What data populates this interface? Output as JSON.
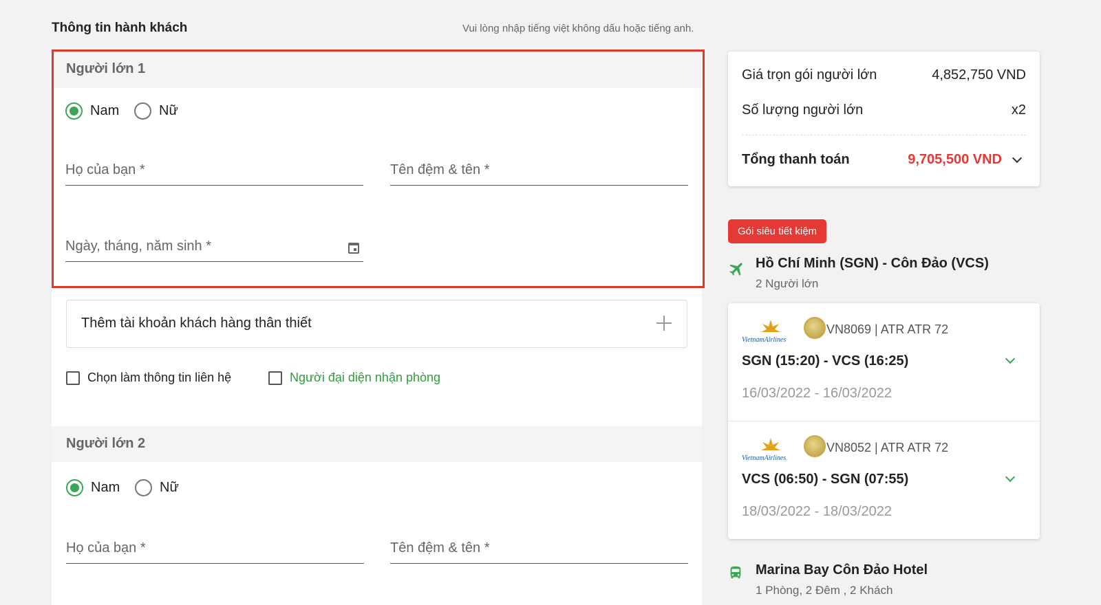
{
  "header": {
    "title": "Thông tin hành khách",
    "hint": "Vui lòng nhập tiếng việt không dấu hoặc tiếng anh."
  },
  "adult1": {
    "title": "Người lớn 1",
    "gender_male": "Nam",
    "gender_female": "Nữ",
    "selected_gender": "Nam",
    "last_name_placeholder": "Họ của bạn *",
    "first_name_placeholder": "Tên đệm & tên *",
    "dob_placeholder": "Ngày, tháng, năm sinh *"
  },
  "loyalty": {
    "label": "Thêm tài khoản khách hàng thân thiết"
  },
  "options": {
    "contact_label": "Chọn làm thông tin liên hệ",
    "checkin_rep_label": "Người đại diện nhận phòng"
  },
  "adult2": {
    "title": "Người lớn 2",
    "gender_male": "Nam",
    "gender_female": "Nữ",
    "selected_gender": "Nam",
    "last_name_placeholder": "Họ của bạn *",
    "first_name_placeholder": "Tên đệm & tên *"
  },
  "summary": {
    "package_price_label": "Giá trọn gói người lớn",
    "package_price_value": "4,852,750 VND",
    "adult_count_label": "Số lượng người lớn",
    "adult_count_value": "x2",
    "total_label": "Tổng thanh toán",
    "total_value": "9,705,500 VND"
  },
  "package": {
    "badge": "Gói siêu tiết kiệm",
    "route": "Hồ Chí Minh (SGN) - Côn Đảo (VCS)",
    "passengers": "2 Người lớn"
  },
  "flights": [
    {
      "airline_text": "VietnamAirlines",
      "code": "VN8069 | ATR ATR 72",
      "route": "SGN (15:20) - VCS (16:25)",
      "dates": "16/03/2022 - 16/03/2022"
    },
    {
      "airline_text": "VietnamAirlines",
      "code": "VN8052 | ATR ATR 72",
      "route": "VCS (06:50) - SGN (07:55)",
      "dates": "18/03/2022 - 18/03/2022"
    }
  ],
  "hotel": {
    "name": "Marina Bay Côn Đảo Hotel",
    "details": "1 Phòng, 2 Đêm , 2 Khách"
  },
  "colors": {
    "accent_green": "#3aa655",
    "price_red": "#e53935",
    "highlight_border": "#e0392b"
  }
}
